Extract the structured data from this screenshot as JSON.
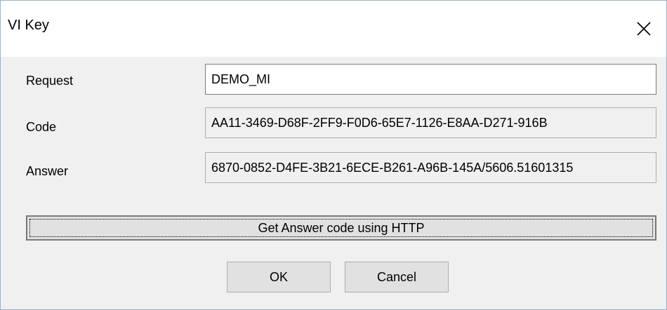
{
  "window": {
    "title": "VI Key",
    "close_icon": "close-icon"
  },
  "form": {
    "request_label": "Request",
    "request_value": "DEMO_MI",
    "code_label": "Code",
    "code_value": "AA11-3469-D68F-2FF9-F0D6-65E7-1126-E8AA-D271-916B",
    "answer_label": "Answer",
    "answer_value": "6870-0852-D4FE-3B21-6ECE-B261-A96B-145A/5606.51601315"
  },
  "buttons": {
    "http_label": "Get Answer code using HTTP",
    "ok_label": "OK",
    "cancel_label": "Cancel"
  }
}
